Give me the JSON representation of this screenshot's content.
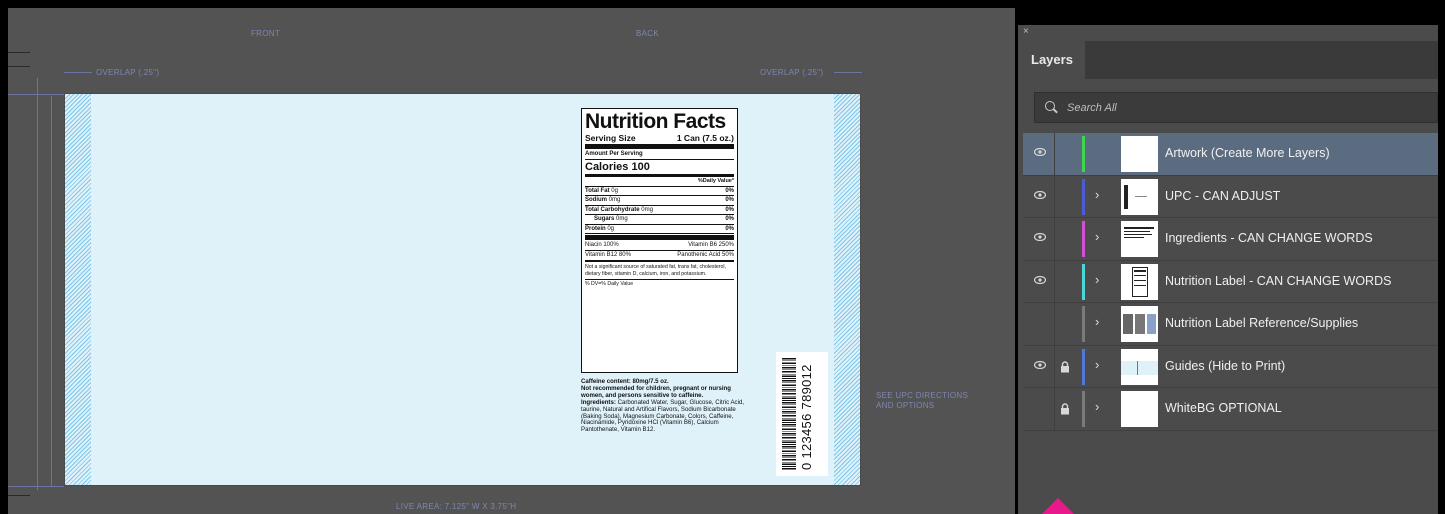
{
  "canvas": {
    "guides": {
      "front": "FRONT",
      "back": "BACK",
      "overlap_left": "OVERLAP (.25\")",
      "overlap_right": "OVERLAP (.25\")",
      "upc_note_1": "SEE UPC DIRECTIONS",
      "upc_note_2": "AND OPTIONS",
      "live_area": "LIVE AREA: 7.125\" W X 3.75\"H"
    },
    "nutrition": {
      "title": "Nutrition Facts",
      "serving_label": "Serving Size",
      "serving_value": "1 Can (7.5 oz.)",
      "amount_per_serving": "Amount Per Serving",
      "calories": "Calories 100",
      "daily_value_header": "%Daily Value*",
      "rows": [
        {
          "label": "Total Fat",
          "amount": "0g",
          "dv": "0%"
        },
        {
          "label": "Sodium",
          "amount": "0mg",
          "dv": "0%"
        },
        {
          "label": "Total Carbohydrate",
          "amount": "0mg",
          "dv": "0%"
        },
        {
          "label": "Sugars",
          "amount": "0mg",
          "dv": "0%"
        },
        {
          "label": "Protein",
          "amount": "0g",
          "dv": "0%"
        }
      ],
      "vitamins": [
        {
          "left": "Niacin 100%",
          "right": "Vitamin B6 250%"
        },
        {
          "left": "Vitamin B12 80%",
          "right": "Panothenic Acid 50%"
        }
      ],
      "note": "Not a significant source of saturated fat, trans fat, cholesterol, dietary fiber, vitamin D, calcium, iron, and potassium.",
      "legend": "% DV=% Daily Value"
    },
    "caffeine": {
      "line1": "Caffeine content: 80mg/7.5 oz.",
      "warning": "Not recommended for children, pregnant or nursing women, and persons sensitive to caffeine.",
      "ingredients_label": "Ingredients:",
      "ingredients": "Carbonated Water, Sugar, Glucose, Citric Acid, taurine, Natural and Artifical Flavors, Sodium Bicarbonate (Baking Soda), Magnesium Carbonate, Colors, Caffeine, Niacinamide, Pyridoxine HCl (Vitamin B6), Calcium Pantothenate, Vitamin B12."
    },
    "upc": {
      "digits": "0 123456 789012"
    }
  },
  "panel": {
    "close_glyph": "×",
    "tab_label": "Layers",
    "search_placeholder": "Search All",
    "layers": [
      {
        "name": "Artwork (Create More Layers)",
        "visible": true,
        "locked": false,
        "color": "#3ed64a",
        "expandable": false,
        "selected": true
      },
      {
        "name": "UPC - CAN ADJUST",
        "visible": true,
        "locked": false,
        "color": "#4f5bd6",
        "expandable": true,
        "selected": false
      },
      {
        "name": "Ingredients - CAN CHANGE WORDS",
        "visible": true,
        "locked": false,
        "color": "#d04fd6",
        "expandable": true,
        "selected": false
      },
      {
        "name": "Nutrition Label - CAN CHANGE WORDS",
        "visible": true,
        "locked": false,
        "color": "#4fd6d6",
        "expandable": true,
        "selected": false
      },
      {
        "name": "Nutrition Label Reference/Supplies",
        "visible": false,
        "locked": false,
        "color": "#7a7a7a",
        "expandable": true,
        "selected": false
      },
      {
        "name": "Guides (Hide to Print)",
        "visible": true,
        "locked": true,
        "color": "#4f79d6",
        "expandable": true,
        "selected": false
      },
      {
        "name": "WhiteBG OPTIONAL",
        "visible": false,
        "locked": true,
        "color": "#7a7a7a",
        "expandable": true,
        "selected": false
      }
    ]
  },
  "colors": {
    "canvas_bg": "#535353",
    "artboard_bg": "#dff1f9",
    "panel_bg": "#4b4b4b",
    "selection": "#5c6c80",
    "accent_pink": "#e8198b"
  }
}
